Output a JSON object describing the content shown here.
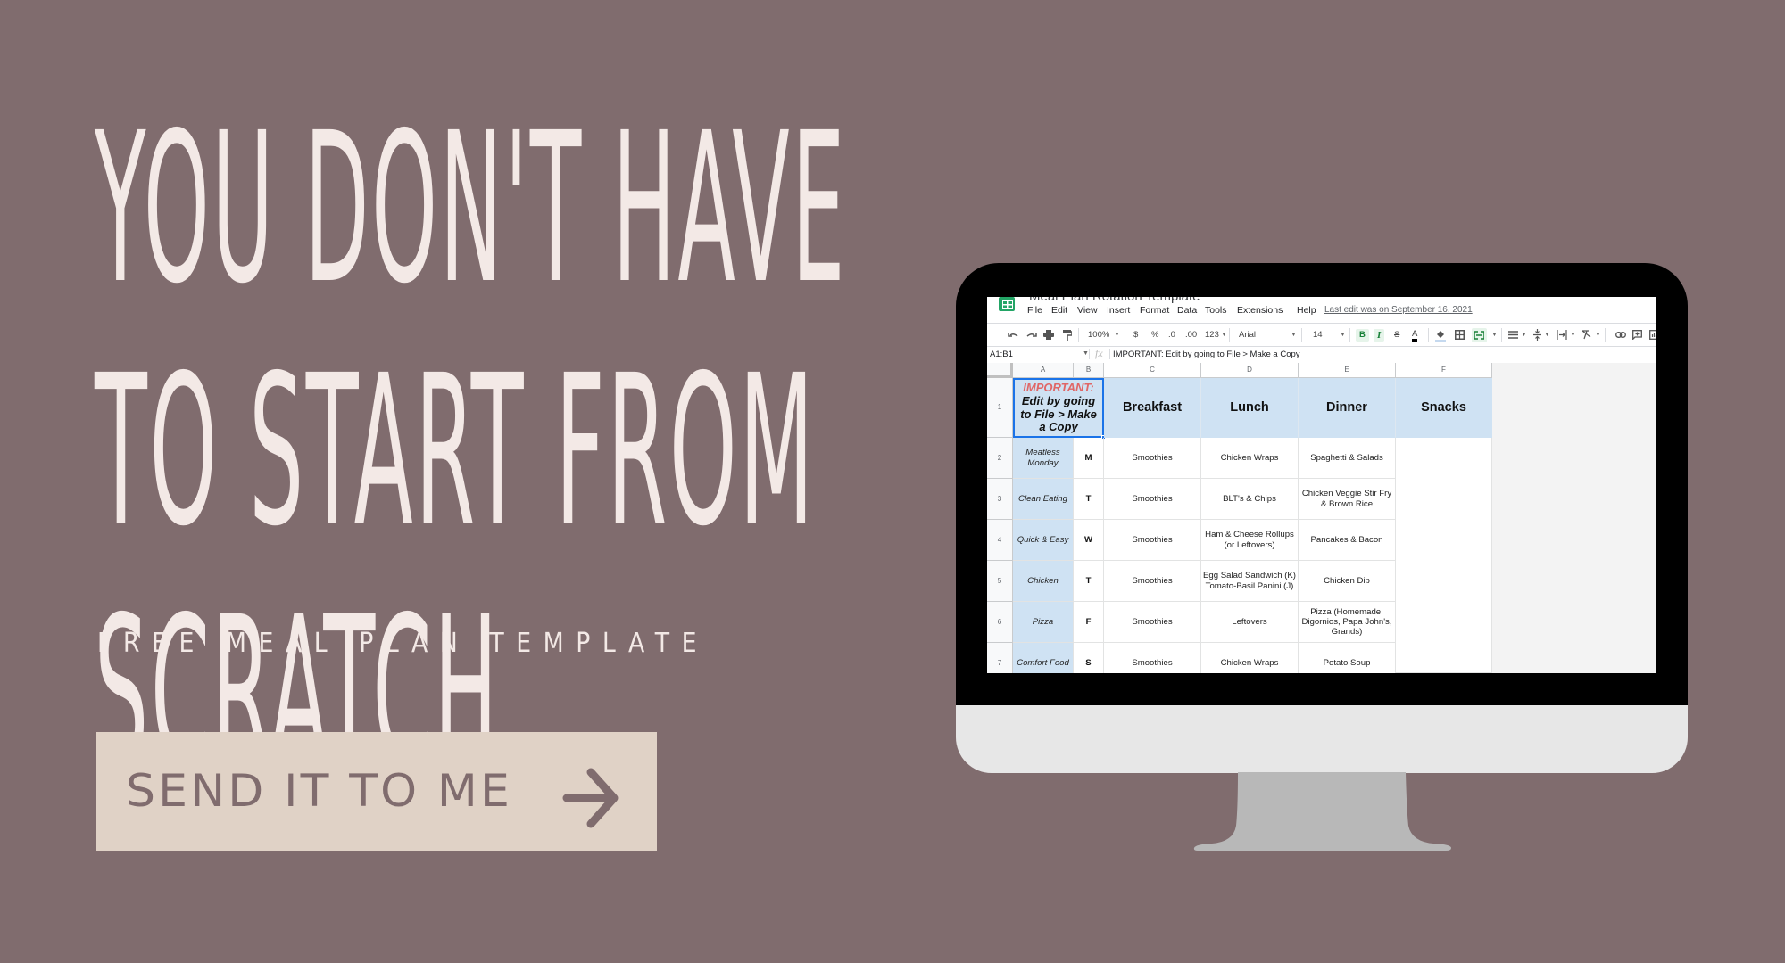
{
  "headline": {
    "lines": [
      "YOU DON'T HAVE",
      "TO START FROM",
      "SCRATCH"
    ]
  },
  "subtitle": "FREE MEAL PLAN TEMPLATE",
  "cta": {
    "label": "SEND IT TO ME",
    "icon": "arrow-right-icon"
  },
  "colors": {
    "background": "#806c6e",
    "headline_text": "#f3e9e6",
    "button_bg": "#e0d2c6",
    "button_text": "#806c6e",
    "sheet_header_fill": "#cfe2f3",
    "important_red": "#e06666",
    "selection_blue": "#1a73e8"
  },
  "spreadsheet": {
    "doc_title": "Meal Plan Rotation Template",
    "app_icon": "google-sheets-icon",
    "menu": [
      "File",
      "Edit",
      "View",
      "Insert",
      "Format",
      "Data",
      "Tools",
      "Extensions",
      "Help"
    ],
    "last_edit": "Last edit was on September 16, 2021",
    "toolbar": {
      "zoom": "100%",
      "currency": "$",
      "percent": "%",
      "decrease_decimal": ".0",
      "increase_decimal": ".00",
      "more_formats": "123",
      "font": "Arial",
      "font_size": "14",
      "bold": "B",
      "italic": "I",
      "strikethrough": "S",
      "text_color": "A"
    },
    "name_box": "A1:B1",
    "fx": "fx",
    "formula": "IMPORTANT: Edit by going to File > Make a Copy",
    "column_headers": [
      "A",
      "B",
      "C",
      "D",
      "E",
      "F"
    ],
    "row_numbers": [
      "1",
      "2",
      "3",
      "4",
      "5",
      "6",
      "7"
    ],
    "a1": {
      "important": "IMPORTANT:",
      "line1": "Edit by going",
      "line2": "to File > Make",
      "line3": "a Copy"
    },
    "meal_headers": [
      "Breakfast",
      "Lunch",
      "Dinner",
      "Snacks"
    ],
    "rows": [
      {
        "theme": "Meatless Monday",
        "day": "M",
        "breakfast": "Smoothies",
        "lunch": "Chicken Wraps",
        "dinner": "Spaghetti &  Salads"
      },
      {
        "theme": "Clean Eating",
        "day": "T",
        "breakfast": "Smoothies",
        "lunch": "BLT's & Chips",
        "dinner": "Chicken Veggie Stir Fry & Brown Rice"
      },
      {
        "theme": "Quick & Easy",
        "day": "W",
        "breakfast": "Smoothies",
        "lunch": "Ham & Cheese Rollups (or Leftovers)",
        "dinner": "Pancakes & Bacon"
      },
      {
        "theme": "Chicken",
        "day": "T",
        "breakfast": "Smoothies",
        "lunch": "Egg Salad Sandwich (K) Tomato-Basil Panini (J)",
        "dinner": "Chicken Dip"
      },
      {
        "theme": "Pizza",
        "day": "F",
        "breakfast": "Smoothies",
        "lunch": "Leftovers",
        "dinner": "Pizza (Homemade, Digornios, Papa John's, Grands)"
      },
      {
        "theme": "Comfort Food",
        "day": "S",
        "breakfast": "Smoothies",
        "lunch": "Chicken Wraps",
        "dinner": "Potato Soup"
      }
    ]
  }
}
